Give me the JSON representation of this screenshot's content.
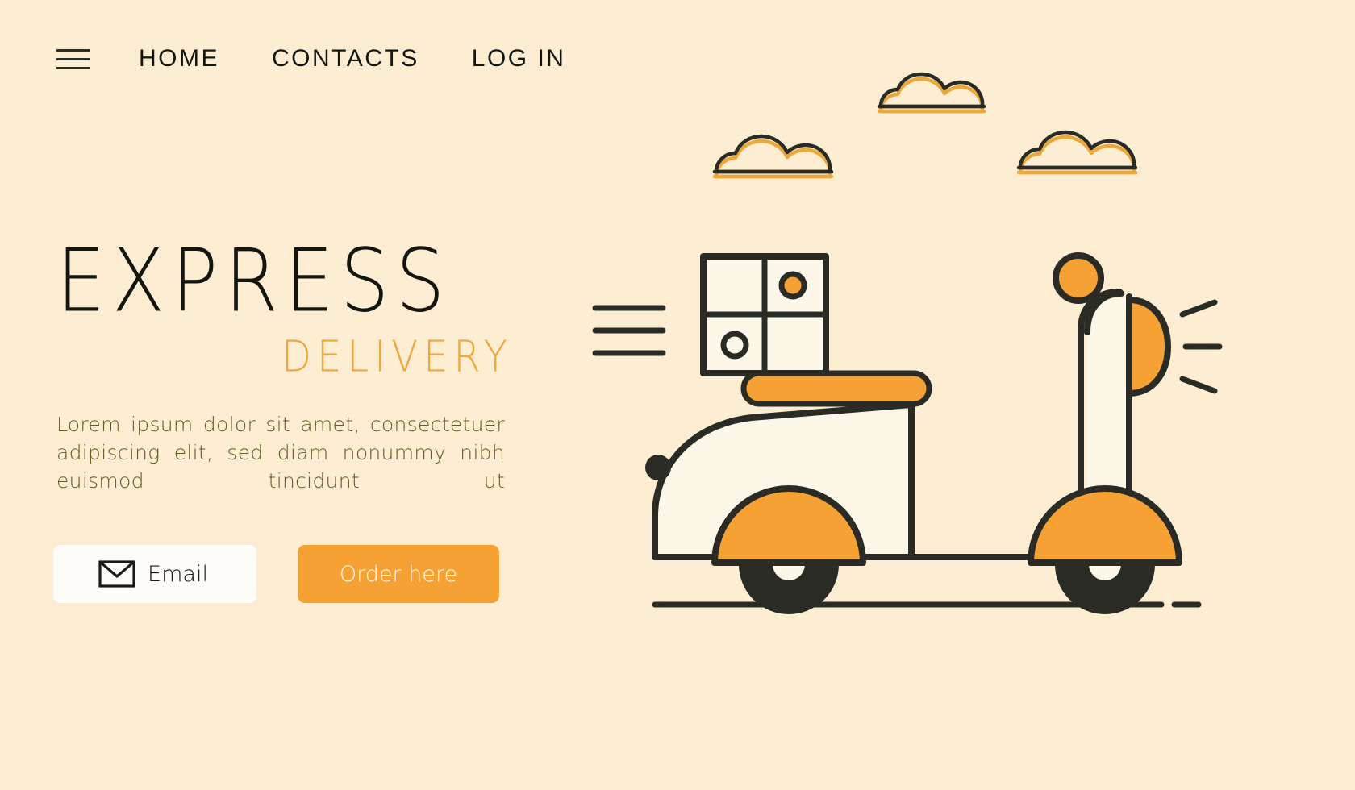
{
  "page": {
    "background_color": "#fcedd3",
    "accent_color": "#f5a133",
    "dark_color": "#2b2b26",
    "text_color": "#6a5a22"
  },
  "nav": {
    "menu_icon": "hamburger-icon",
    "links": [
      {
        "label": "HOME"
      },
      {
        "label": "CONTACTS"
      },
      {
        "label": "LOG IN"
      }
    ]
  },
  "hero": {
    "title_line1": "EXPRESS",
    "title_line2": "DELIVERY",
    "paragraph": "Lorem ipsum dolor sit amet, consectetuer adipiscing elit, sed diam nonummy nibh euismod tincidunt ut"
  },
  "buttons": {
    "email": {
      "label": "Email",
      "icon": "envelope-icon",
      "background": "#fdfcf8",
      "text_color": "#1b1b16"
    },
    "order": {
      "label": "Order here",
      "background": "#f5a133",
      "text_color": "#fff9ee"
    }
  },
  "illustration": {
    "name": "scooter-delivery-illustration",
    "elements": [
      "cloud-left",
      "cloud-top",
      "cloud-right",
      "speed-lines",
      "delivery-box",
      "scooter-seat",
      "scooter-body",
      "front-wheel",
      "rear-wheel",
      "handlebar",
      "mirror",
      "headlight",
      "headlight-rays",
      "road-line"
    ],
    "colors": {
      "outline": "#2b2b26",
      "fill_light": "#fdf7ea",
      "accent": "#f5a133",
      "cloud_accent": "#eda83a"
    }
  }
}
